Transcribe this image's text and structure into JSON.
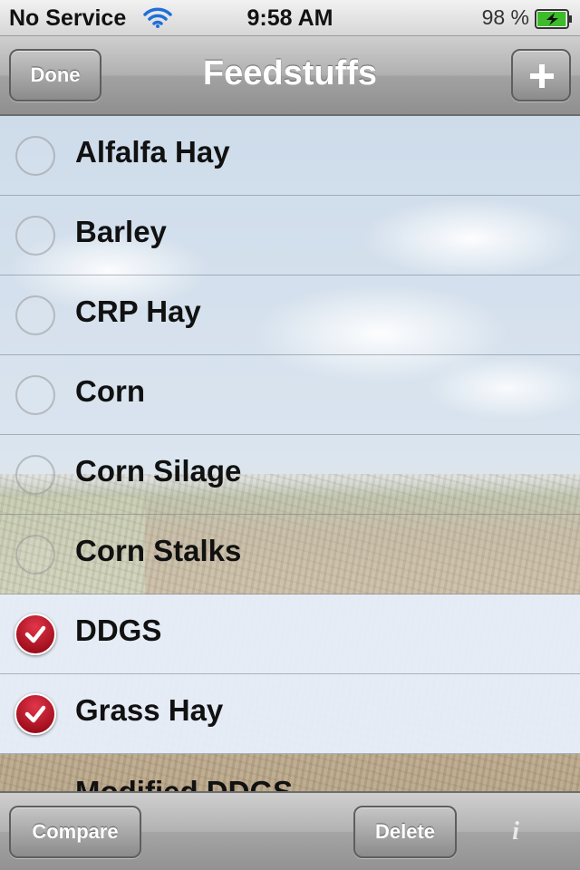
{
  "status_bar": {
    "carrier": "No Service",
    "time": "9:58 AM",
    "battery_percent": "98 %",
    "battery_level": 0.98,
    "icons": [
      "wifi-icon",
      "battery-charging-icon"
    ]
  },
  "nav": {
    "title": "Feedstuffs",
    "done_label": "Done",
    "add_icon": "plus-icon"
  },
  "feedstuffs": [
    {
      "name": "Alfalfa Hay",
      "checked": false
    },
    {
      "name": "Barley",
      "checked": false
    },
    {
      "name": "CRP Hay",
      "checked": false
    },
    {
      "name": "Corn",
      "checked": false
    },
    {
      "name": "Corn Silage",
      "checked": false
    },
    {
      "name": "Corn Stalks",
      "checked": false
    },
    {
      "name": "DDGS",
      "checked": true
    },
    {
      "name": "Grass Hay",
      "checked": true
    },
    {
      "name": "Modified DDGS",
      "checked": false
    }
  ],
  "toolbar": {
    "compare_label": "Compare",
    "delete_label": "Delete",
    "info_icon": "info-icon",
    "info_glyph": "i"
  },
  "colors": {
    "check_red": "#b3142a",
    "selected_row": "#e8f0fc"
  }
}
